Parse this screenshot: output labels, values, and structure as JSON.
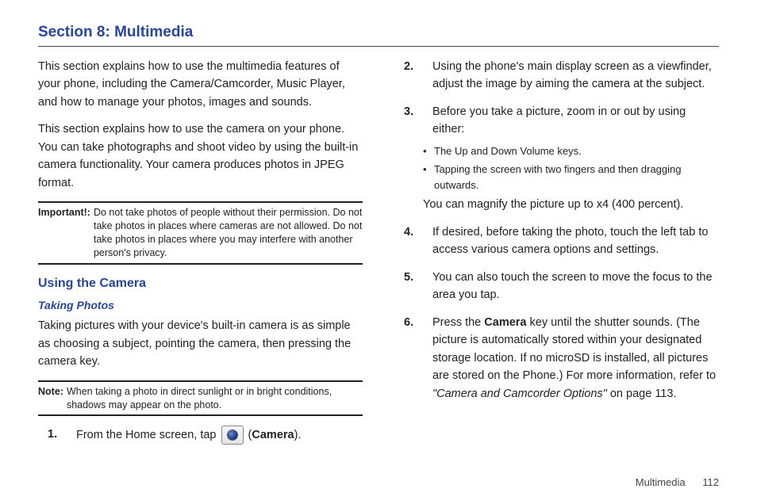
{
  "section_title": "Section 8: Multimedia",
  "left": {
    "para1": "This section explains how to use the multimedia features of your phone, including the Camera/Camcorder, Music Player, and how to manage your photos, images and sounds.",
    "para2": "This section explains how to use the camera on your phone. You can take photographs and shoot video by using the built-in camera functionality. Your camera produces photos in JPEG format.",
    "important_label": "Important!:",
    "important_text": "Do not take photos of people without their permission. Do not take photos in places where cameras are not allowed. Do not take photos in places where you may interfere with another person's privacy.",
    "h2": "Using the Camera",
    "h3": "Taking Photos",
    "para3": "Taking pictures with your device's built-in camera is as simple as choosing a subject, pointing the camera, then pressing the camera key.",
    "note_label": "Note:",
    "note_text": "When taking a photo in direct sunlight or in bright conditions, shadows may appear on the photo.",
    "step1_num": "1.",
    "step1_pre": "From the Home screen, tap ",
    "step1_post_open": " (",
    "step1_bold": "Camera",
    "step1_post_close": ")."
  },
  "right": {
    "step2_num": "2.",
    "step2": "Using the phone's main display screen as a viewfinder, adjust the image by aiming the camera at the subject.",
    "step3_num": "3.",
    "step3": "Before you take a picture, zoom in or out by using either:",
    "bullet1": "The Up and Down Volume keys.",
    "bullet2": "Tapping the screen with two fingers and then dragging outwards.",
    "step3_tail": "You can magnify the picture up to x4 (400 percent).",
    "step4_num": "4.",
    "step4": "If desired, before taking the photo, touch the left tab to access various camera options and settings.",
    "step5_num": "5.",
    "step5": "You can also touch the screen to move the focus to the area you tap.",
    "step6_num": "6.",
    "step6_pre": "Press the ",
    "step6_bold": "Camera",
    "step6_mid": " key until the shutter sounds. (The picture is automatically stored within your designated storage location. If no microSD is installed, all pictures are stored on the Phone.) For more information, refer to ",
    "step6_italic": "\"Camera and Camcorder Options\"",
    "step6_post": "  on page 113."
  },
  "footer": {
    "label": "Multimedia",
    "page": "112"
  }
}
